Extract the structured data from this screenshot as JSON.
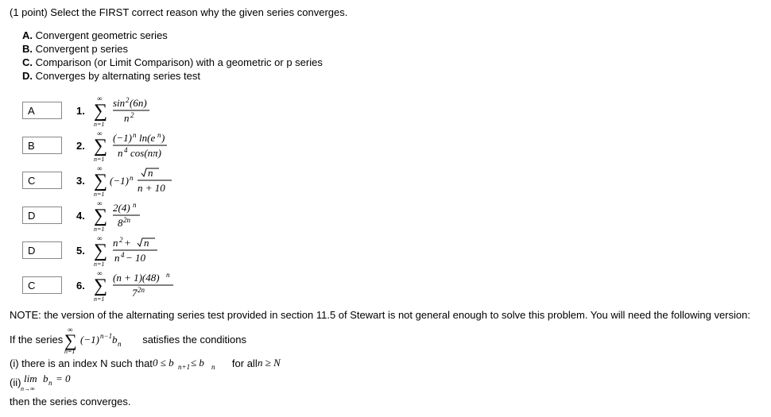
{
  "question": "(1 point) Select the FIRST correct reason why the given series converges.",
  "optionA_label": "A.",
  "optionA_text": " Convergent geometric series",
  "optionB_label": "B.",
  "optionB_text": " Convergent p series",
  "optionC_label": "C.",
  "optionC_text": " Comparison (or Limit Comparison) with a geometric or p series",
  "optionD_label": "D.",
  "optionD_text": " Converges by alternating series test",
  "problems": [
    {
      "answer": "A",
      "num": "1.",
      "tex": "\\sum_{n=1}^{\\infty} \\frac{\\sin^2(6n)}{n^2}"
    },
    {
      "answer": "B",
      "num": "2.",
      "tex": "\\sum_{n=1}^{\\infty} \\frac{(-1)^n \\ln(e^n)}{n^4 \\cos(n\\pi)}"
    },
    {
      "answer": "C",
      "num": "3.",
      "tex": "\\sum_{n=1}^{\\infty} (-1)^n \\frac{\\sqrt{n}}{n+10}"
    },
    {
      "answer": "D",
      "num": "4.",
      "tex": "\\sum_{n=1}^{\\infty} \\frac{2(4)^n}{8^{2n}}"
    },
    {
      "answer": "D",
      "num": "5.",
      "tex": "\\sum_{n=1}^{\\infty} \\frac{n^2+\\sqrt{n}}{n^4-10}"
    },
    {
      "answer": "C",
      "num": "6.",
      "tex": "\\sum_{n=1}^{\\infty} \\frac{(n+1)(48)^n}{7^{2n}}"
    }
  ],
  "note_line": "NOTE: the version of the alternating series test provided in section 11.5 of Stewart is not general enough to solve this problem. You will need the following version:",
  "ifseries_pre": "If the series ",
  "ifseries_post": " satisfies the conditions",
  "cond1_pre": "(i) there is an index N such that ",
  "cond1_post": " for all ",
  "cond2_pre": "(ii) ",
  "then_line": "then the series converges.",
  "chart_data": null
}
